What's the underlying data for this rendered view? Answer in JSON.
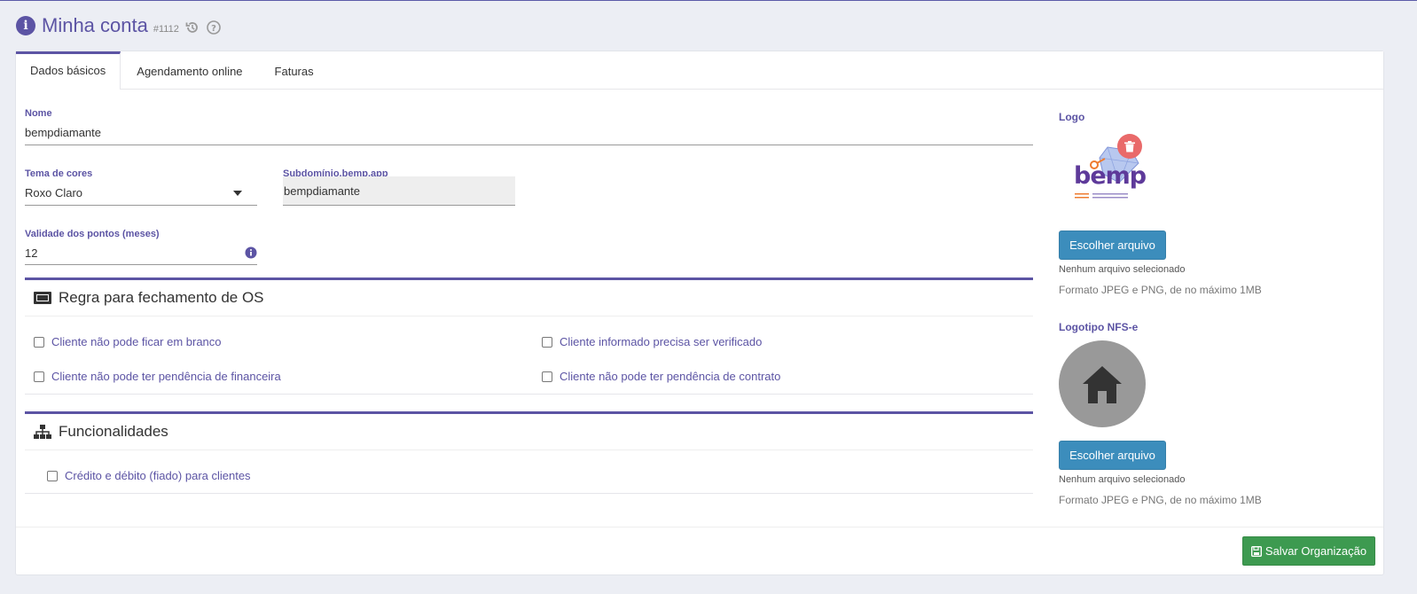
{
  "header": {
    "title": "Minha conta",
    "id": "#1112"
  },
  "tabs": [
    {
      "label": "Dados básicos",
      "active": true
    },
    {
      "label": "Agendamento online",
      "active": false
    },
    {
      "label": "Faturas",
      "active": false
    }
  ],
  "form": {
    "nome": {
      "label": "Nome",
      "value": "bempdiamante"
    },
    "tema": {
      "label": "Tema de cores",
      "value": "Roxo Claro"
    },
    "subdominio": {
      "label": "Subdomínio.bemp.app",
      "value": "bempdiamante"
    },
    "validade": {
      "label": "Validade dos pontos (meses)",
      "value": "12"
    }
  },
  "section_os": {
    "title": "Regra para fechamento de OS",
    "checks": [
      {
        "label": "Cliente não pode ficar em branco",
        "checked": false
      },
      {
        "label": "Cliente informado precisa ser verificado",
        "checked": false
      },
      {
        "label": "Cliente não pode ter pendência de financeira",
        "checked": false
      },
      {
        "label": "Cliente não pode ter pendência de contrato",
        "checked": false
      }
    ]
  },
  "section_func": {
    "title": "Funcionalidades",
    "checks": [
      {
        "label": "Crédito e débito (fiado) para clientes",
        "checked": false
      }
    ]
  },
  "logo": {
    "label": "Logo",
    "brand_text": "bemp",
    "button": "Escolher arquivo",
    "no_file": "Nenhum arquivo selecionado",
    "hint": "Formato JPEG e PNG, de no máximo 1MB"
  },
  "logo_nfse": {
    "label": "Logotipo NFS-e",
    "button": "Escolher arquivo",
    "no_file": "Nenhum arquivo selecionado",
    "hint": "Formato JPEG e PNG, de no máximo 1MB"
  },
  "save_button": "Salvar Organização",
  "colors": {
    "accent": "#5c54a4",
    "primary_button": "#3c8dbc",
    "success_button": "#3d9a50",
    "delete_badge": "#e55353"
  }
}
